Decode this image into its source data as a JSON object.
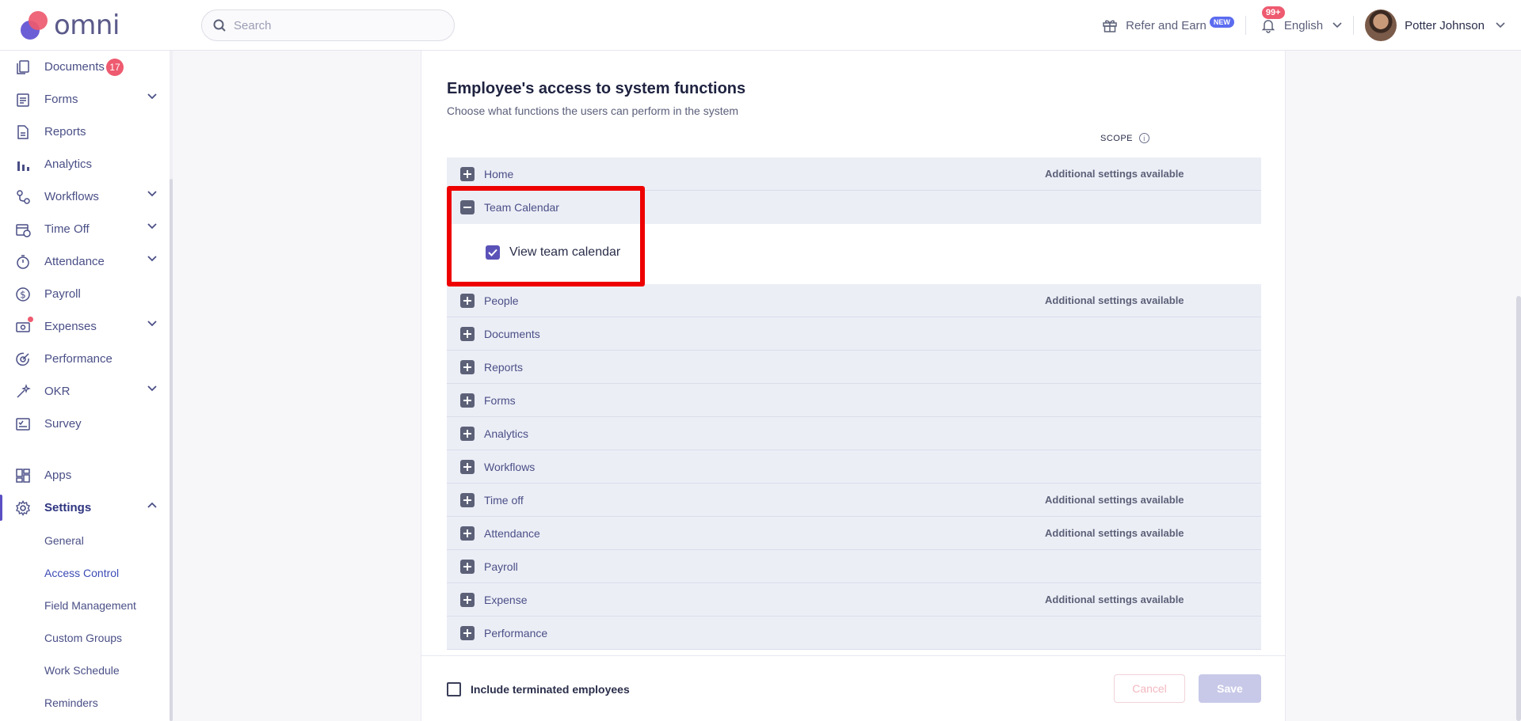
{
  "app": {
    "logo_text": "omni"
  },
  "topbar": {
    "search_placeholder": "Search",
    "refer_label": "Refer and Earn",
    "refer_badge": "NEW",
    "notifications_count": "99+",
    "language": "English",
    "user_name": "Potter Johnson"
  },
  "sidebar": {
    "items": [
      {
        "label": "Documents",
        "badge": "17"
      },
      {
        "label": "Forms"
      },
      {
        "label": "Reports"
      },
      {
        "label": "Analytics"
      },
      {
        "label": "Workflows"
      },
      {
        "label": "Time Off"
      },
      {
        "label": "Attendance"
      },
      {
        "label": "Payroll"
      },
      {
        "label": "Expenses"
      },
      {
        "label": "Performance"
      },
      {
        "label": "OKR"
      },
      {
        "label": "Survey"
      },
      {
        "label": "Apps"
      },
      {
        "label": "Settings"
      }
    ],
    "settings_sub": [
      {
        "label": "General"
      },
      {
        "label": "Access Control"
      },
      {
        "label": "Field Management"
      },
      {
        "label": "Custom Groups"
      },
      {
        "label": "Work Schedule"
      },
      {
        "label": "Reminders"
      }
    ]
  },
  "main": {
    "title": "Employee's access to system functions",
    "subtitle": "Choose what functions the users can perform in the system",
    "scope_label": "SCOPE",
    "additional_text": "Additional settings available",
    "rows": [
      {
        "label": "Home",
        "additional": true
      },
      {
        "label": "Team Calendar",
        "expanded": true,
        "permission": "View team calendar",
        "checked": true
      },
      {
        "label": "People",
        "additional": true
      },
      {
        "label": "Documents"
      },
      {
        "label": "Reports"
      },
      {
        "label": "Forms"
      },
      {
        "label": "Analytics"
      },
      {
        "label": "Workflows"
      },
      {
        "label": "Time off",
        "additional": true
      },
      {
        "label": "Attendance",
        "additional": true
      },
      {
        "label": "Payroll"
      },
      {
        "label": "Expense",
        "additional": true
      },
      {
        "label": "Performance"
      }
    ]
  },
  "footer": {
    "include_terminated": "Include terminated employees",
    "cancel": "Cancel",
    "save": "Save"
  },
  "colors": {
    "accent": "#5b4fc4",
    "badge": "#ee5a6f",
    "highlight": "#ee0000"
  }
}
